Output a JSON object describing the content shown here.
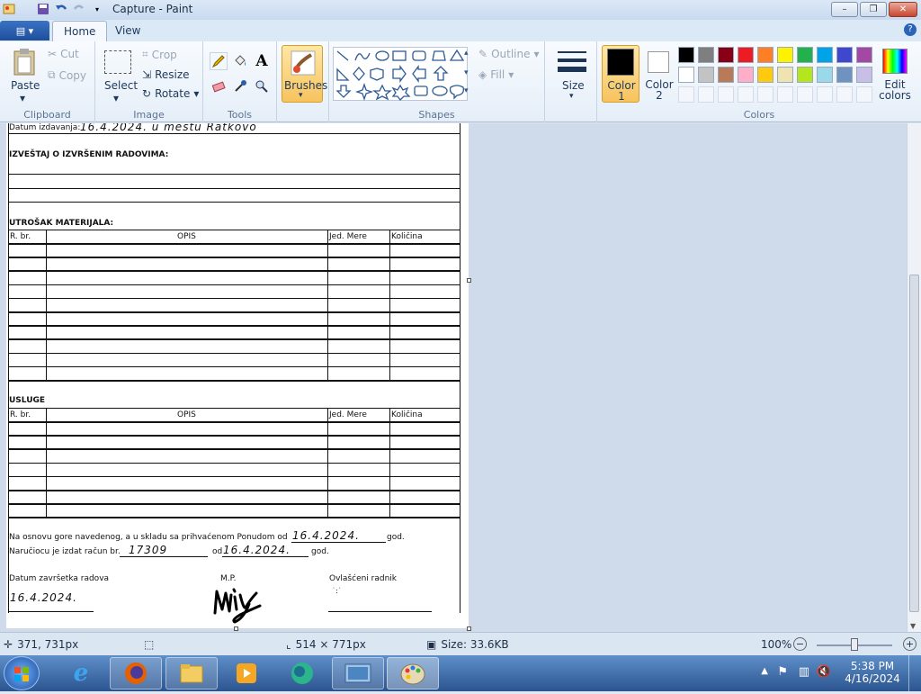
{
  "window": {
    "title": "Capture - Paint",
    "min": "–",
    "max": "❐",
    "close": "✕"
  },
  "tabs": {
    "home": "Home",
    "view": "View"
  },
  "ribbon": {
    "clipboard": {
      "label": "Clipboard",
      "paste": "Paste",
      "cut": "Cut",
      "copy": "Copy"
    },
    "image": {
      "label": "Image",
      "select": "Select",
      "crop": "Crop",
      "resize": "Resize",
      "rotate": "Rotate"
    },
    "tools": {
      "label": "Tools"
    },
    "brushes": {
      "label": "Brushes"
    },
    "shapes": {
      "label": "Shapes",
      "outline": "Outline",
      "fill": "Fill"
    },
    "size": {
      "label": "Size"
    },
    "colors": {
      "label": "Colors",
      "color1": "Color 1",
      "color2": "Color 2",
      "edit": "Edit colors",
      "palette_row1": [
        "#000000",
        "#7f7f7f",
        "#880015",
        "#ed1c24",
        "#ff7f27",
        "#fff200",
        "#22b14c",
        "#00a2e8",
        "#3f48cc",
        "#a349a4"
      ],
      "palette_row2": [
        "#ffffff",
        "#c3c3c3",
        "#b97a57",
        "#ffaec9",
        "#ffc90e",
        "#efe4b0",
        "#b5e61d",
        "#99d9ea",
        "#7092be",
        "#c8bfe7"
      ]
    }
  },
  "form": {
    "issue_label": "Datum izdavanja:",
    "issue_value": "16.4.2024. u mestu Ratkovo",
    "report_title": "IZVEŠTAJ O IZVRŠENIM RADOVIMA:",
    "material_title": "UTROŠAK MATERIJALA:",
    "services_title": "USLUGE",
    "col_rbr": "R. br.",
    "col_opis": "OPIS",
    "col_jed": "Jed. Mere",
    "col_kol": "Količina",
    "line1_a": "Na osnovu gore navedenog, a u skladu sa prihvaćenom Ponudom  od",
    "line1_date": "16.4.2024.",
    "line1_b": "god.",
    "line2_a": "Naručiocu je izdat račun br.",
    "line2_num": "17309",
    "line2_od": "od",
    "line2_date": "16.4.2024.",
    "line2_b": "god.",
    "finish_label": "Datum završetka radova",
    "mp_label": "M.P.",
    "worker_label": "Ovlašćeni radnik",
    "finish_value": "16.4.2024."
  },
  "status": {
    "cursor": "371, 731px",
    "size": "514 × 771px",
    "filesize": "Size: 33.6KB",
    "zoom": "100%"
  },
  "tray": {
    "time": "5:38 PM",
    "date": "4/16/2024"
  }
}
